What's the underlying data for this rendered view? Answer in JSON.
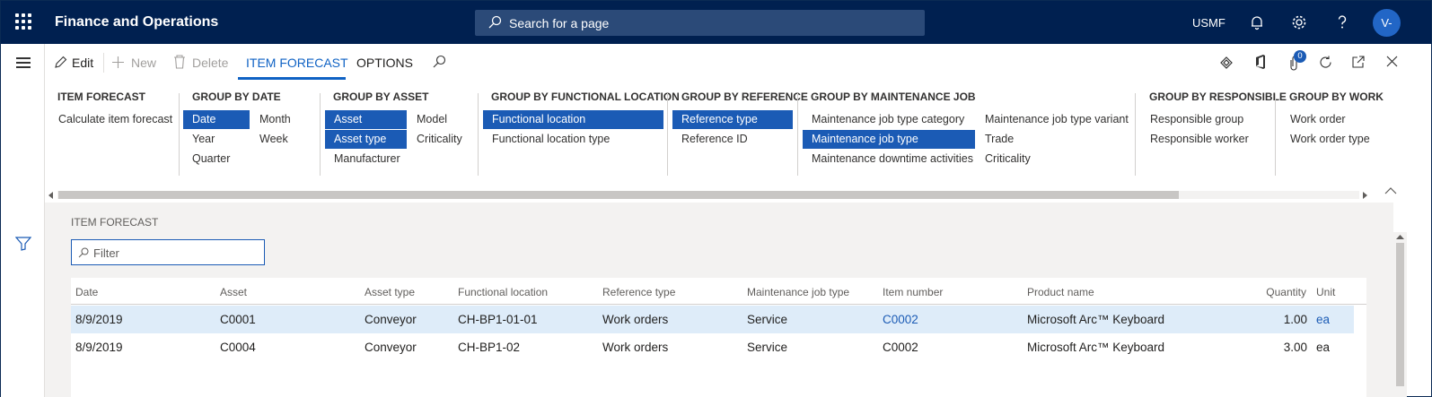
{
  "app": {
    "title": "Finance and Operations",
    "company": "USMF",
    "user_initials": "V-"
  },
  "search": {
    "placeholder": "Search for a page"
  },
  "action_pane": {
    "edit": "Edit",
    "new": "New",
    "delete": "Delete",
    "tabs": [
      "ITEM FORECAST",
      "OPTIONS"
    ],
    "badge_count": "0"
  },
  "ribbon": {
    "item_forecast": {
      "title": "ITEM FORECAST",
      "buttons": [
        "Calculate item forecast"
      ]
    },
    "group_by_date": {
      "title": "GROUP BY DATE",
      "buttons": [
        "Date",
        "Year",
        "Quarter",
        "Month",
        "Week"
      ]
    },
    "group_by_asset": {
      "title": "GROUP BY ASSET",
      "buttons": [
        "Asset",
        "Asset type",
        "Manufacturer",
        "Model",
        "Criticality"
      ]
    },
    "group_by_functional_location": {
      "title": "GROUP BY FUNCTIONAL LOCATION",
      "buttons": [
        "Functional location",
        "Functional location type"
      ]
    },
    "group_by_reference": {
      "title": "GROUP BY REFERENCE",
      "buttons": [
        "Reference type",
        "Reference ID"
      ]
    },
    "group_by_maintenance_job": {
      "title": "GROUP BY MAINTENANCE JOB",
      "buttons": [
        "Maintenance job type category",
        "Maintenance job type",
        "Maintenance downtime activities",
        "Maintenance job type variant",
        "Trade",
        "Criticality"
      ]
    },
    "group_by_responsible": {
      "title": "GROUP BY RESPONSIBLE",
      "buttons": [
        "Responsible group",
        "Responsible worker"
      ]
    },
    "group_by_work": {
      "title": "GROUP BY WORK",
      "buttons": [
        "Work order",
        "Work order type"
      ]
    }
  },
  "content": {
    "section_title": "ITEM FORECAST",
    "filter_placeholder": "Filter",
    "columns": [
      "Date",
      "Asset",
      "Asset type",
      "Functional location",
      "Reference type",
      "Maintenance job type",
      "Item number",
      "Product name",
      "Quantity",
      "Unit"
    ],
    "rows": [
      [
        "8/9/2019",
        "C0001",
        "Conveyor",
        "CH-BP1-01-01",
        "Work orders",
        "Service",
        "C0002",
        "Microsoft Arc™ Keyboard",
        "1.00",
        "ea"
      ],
      [
        "8/9/2019",
        "C0004",
        "Conveyor",
        "CH-BP1-02",
        "Work orders",
        "Service",
        "C0002",
        "Microsoft Arc™ Keyboard",
        "3.00",
        "ea"
      ]
    ]
  },
  "colors": {
    "nav_bg": "#002050",
    "accent": "#1b5bb5",
    "selected_row": "#deecf9"
  }
}
